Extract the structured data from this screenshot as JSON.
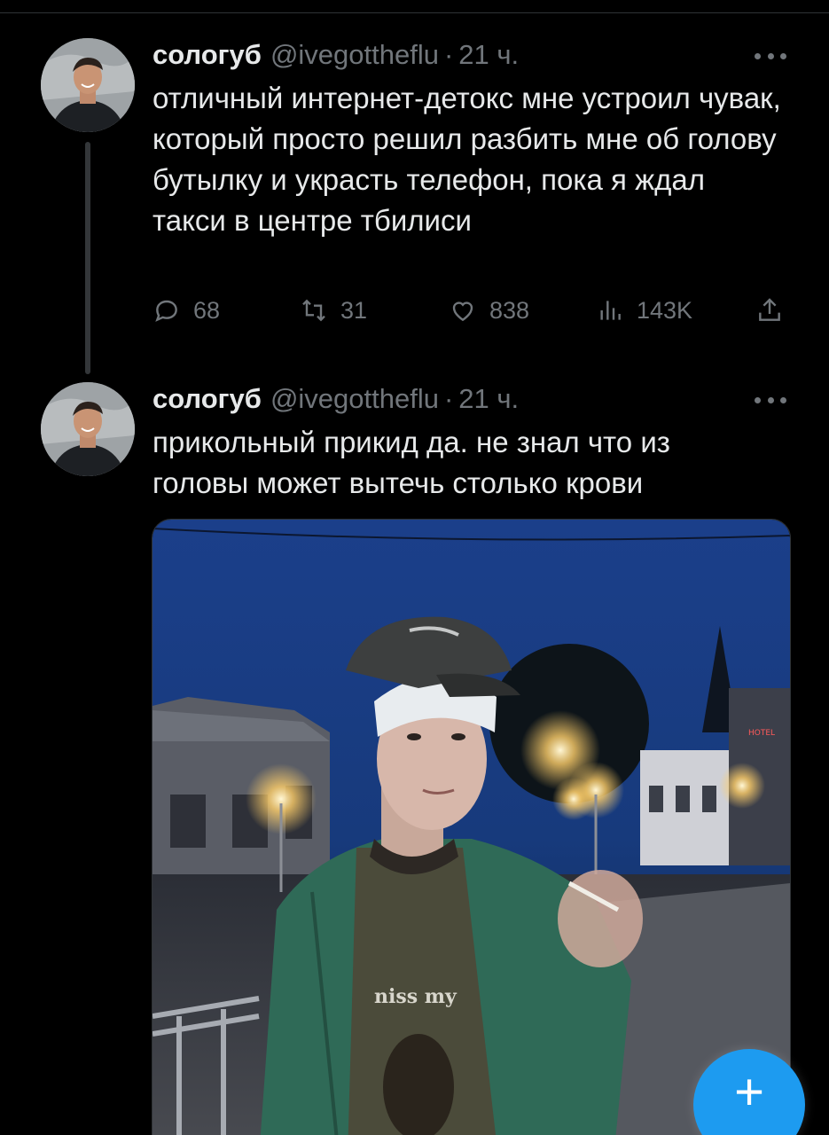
{
  "colors": {
    "background": "#000000",
    "text_primary": "#e7e9ea",
    "text_secondary": "#71767b",
    "accent": "#1d9bf0",
    "divider": "#2f3336"
  },
  "tweets": [
    {
      "author_name": "сологуб",
      "handle": "@ivegottheflu",
      "separator": "·",
      "time": "21 ч.",
      "text": "отличный интернет-детокс мне устроил чувак, который просто решил разбить мне об голову бутылку и украсть телефон, пока я ждал такси в центре тбилиси",
      "actions": {
        "replies": "68",
        "reposts": "31",
        "likes": "838",
        "views": "143K"
      },
      "icons": [
        "reply-icon",
        "repost-icon",
        "like-icon",
        "views-icon",
        "share-icon"
      ]
    },
    {
      "author_name": "сологуб",
      "handle": "@ivegottheflu",
      "separator": "·",
      "time": "21 ч.",
      "text": "прикольный прикид да. не знал что из головы может вытечь столько крови",
      "media": "photo"
    }
  ],
  "compose_button": {
    "icon": "plus-icon",
    "glyph": "+"
  }
}
